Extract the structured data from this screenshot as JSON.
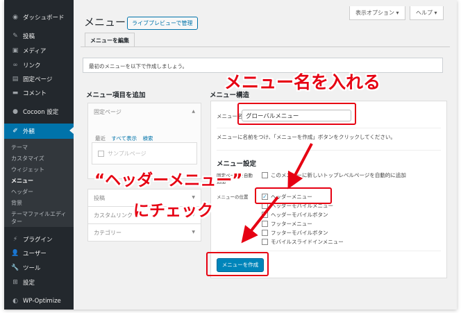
{
  "sidebar": {
    "items": [
      {
        "label": "ダッシュボード",
        "icon": "dashboard-icon",
        "glyph": "◉"
      },
      {
        "label": "投稿",
        "icon": "pin-icon",
        "glyph": "✎"
      },
      {
        "label": "メディア",
        "icon": "media-icon",
        "glyph": "▣"
      },
      {
        "label": "リンク",
        "icon": "link-icon",
        "glyph": "∞"
      },
      {
        "label": "固定ページ",
        "icon": "page-icon",
        "glyph": "▤"
      },
      {
        "label": "コメント",
        "icon": "comment-icon",
        "glyph": "▬"
      },
      {
        "label": "Cocoon 設定",
        "icon": "cocoon-icon",
        "glyph": "●"
      },
      {
        "label": "外観",
        "icon": "appearance-icon",
        "glyph": "✐"
      },
      {
        "label": "プラグイン",
        "icon": "plugin-icon",
        "glyph": "⚡"
      },
      {
        "label": "ユーザー",
        "icon": "user-icon",
        "glyph": "👤"
      },
      {
        "label": "ツール",
        "icon": "tool-icon",
        "glyph": "🔧"
      },
      {
        "label": "設定",
        "icon": "settings-icon",
        "glyph": "⊞"
      },
      {
        "label": "WP-Optimize",
        "icon": "optimize-icon",
        "glyph": "◐"
      }
    ],
    "submenu": [
      "テーマ",
      "カスタマイズ",
      "ウィジェット",
      "メニュー",
      "ヘッダー",
      "背景",
      "テーマファイルエディター"
    ]
  },
  "header": {
    "title": "メニュー",
    "live_preview": "ライブプレビューで管理",
    "screen_options": "表示オプション ▾",
    "help": "ヘルプ ▾",
    "tab": "メニューを編集",
    "notice": "最初のメニューを以下で作成しましょう。"
  },
  "left_panel": {
    "heading": "メニュー項目を追加",
    "fixed_page": "固定ページ",
    "tabs": [
      "最近",
      "すべて表示",
      "検索"
    ],
    "sample_page": "サンプルページ",
    "posts": "投稿",
    "custom_link": "カスタムリンク",
    "category": "カテゴリー"
  },
  "right_panel": {
    "heading": "メニュー構造",
    "name_label": "メニュー名",
    "name_value": "グローバルメニュー",
    "hint": "メニューに名前をつけ、「メニューを作成」ボタンをクリックしてください。",
    "settings_heading": "メニュー設定",
    "auto_add_label": "固定ページを自動",
    "auto_add_cut": "追加",
    "auto_add_option": "このメニューに新しいトップレベルページを自動的に追加",
    "location_label": "メニューの位置",
    "locations": [
      {
        "label": "ヘッダーメニュー",
        "checked": true
      },
      {
        "label": "ヘッダーモバイルメニュー",
        "checked": false
      },
      {
        "label": "ヘッダーモバイルボタン",
        "checked": false
      },
      {
        "label": "フッターメニュー",
        "checked": false
      },
      {
        "label": "フッターモバイルボタン",
        "checked": false
      },
      {
        "label": "モバイルスライドインメニュー",
        "checked": false
      }
    ],
    "create_button": "メニューを作成"
  },
  "annotations": {
    "name_callout": "メニュー名を入れる",
    "check_line1": "“ヘッダーメニュー”",
    "check_line2": "にチェック",
    "color": "#e60012"
  },
  "colors": {
    "accent": "#0073aa",
    "sidebar": "#23282d",
    "annotation": "#e60012"
  }
}
